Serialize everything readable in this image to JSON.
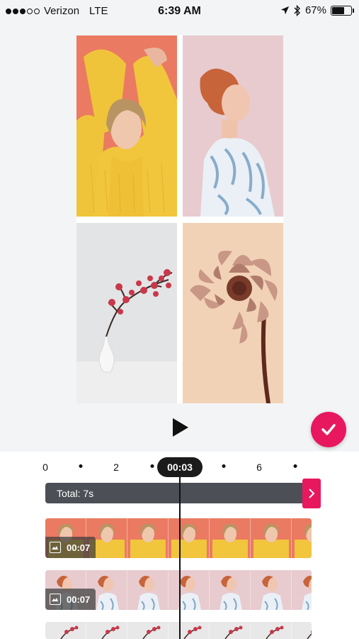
{
  "status_bar": {
    "carrier": "Verizon",
    "network": "LTE",
    "time": "6:39 AM",
    "battery": "67%",
    "battery_level": 0.67,
    "signal_bars_filled": 3,
    "signal_bars_total": 5
  },
  "colors": {
    "accent": "#e8185e",
    "total_bar": "#4d4f56",
    "time_pill": "#1b1b1b"
  },
  "timeline": {
    "ruler_labels": [
      "0",
      "2",
      "6"
    ],
    "current_time": "00:03",
    "total_label": "Total: 7s",
    "tracks": [
      {
        "duration": "00:07"
      },
      {
        "duration": "00:07"
      }
    ]
  }
}
